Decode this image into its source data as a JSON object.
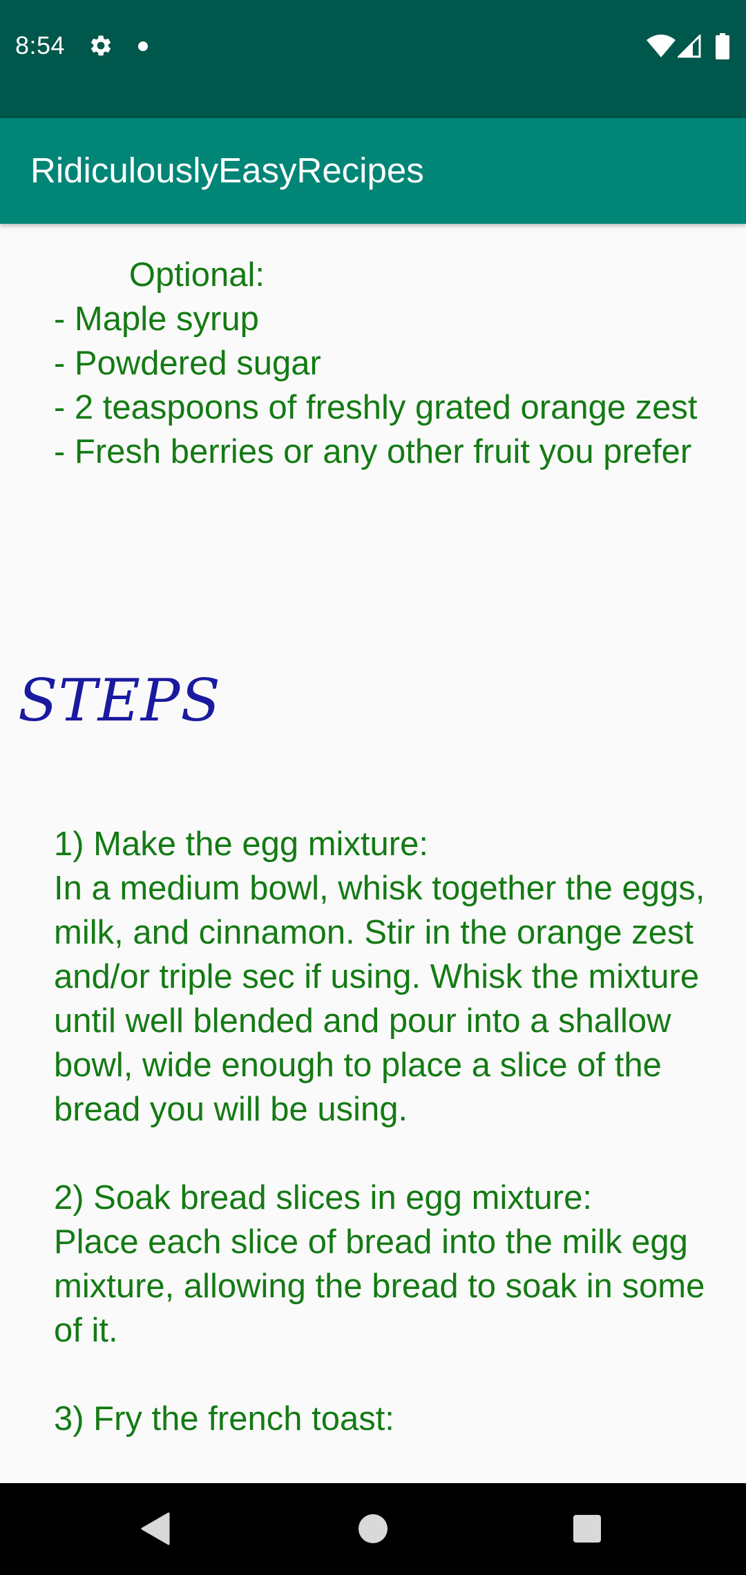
{
  "status_bar": {
    "time": "8:54",
    "icons": [
      "gear-icon",
      "notification-dot-icon",
      "wifi-icon",
      "signal-icon",
      "battery-icon"
    ]
  },
  "app_bar": {
    "title": "RidiculouslyEasyRecipes"
  },
  "content": {
    "optional_text": "        Optional:\n- Maple syrup\n- Powdered sugar\n- 2 teaspoons of freshly grated orange zest\n- Fresh berries or any other fruit you prefer",
    "steps_heading": "STEPS",
    "steps_text": "1) Make the egg mixture:\nIn a medium bowl, whisk together the eggs, milk, and cinnamon. Stir in the orange zest and/or triple sec if using. Whisk the mixture until well blended and pour into a shallow bowl, wide enough to place a slice of the bread you will be using.\n\n2) Soak bread slices in egg mixture:\nPlace each slice of bread into the milk egg mixture, allowing the bread to soak in some of it.\n\n3) Fry the french toast:"
  },
  "colors": {
    "status_bar": "#00574b",
    "app_bar": "#008577",
    "recipe_text": "#147a14",
    "steps_heading": "#1a1aa0",
    "background": "#fafafa"
  },
  "nav_bar": {
    "buttons": [
      "back-icon",
      "home-icon",
      "recents-icon"
    ]
  }
}
